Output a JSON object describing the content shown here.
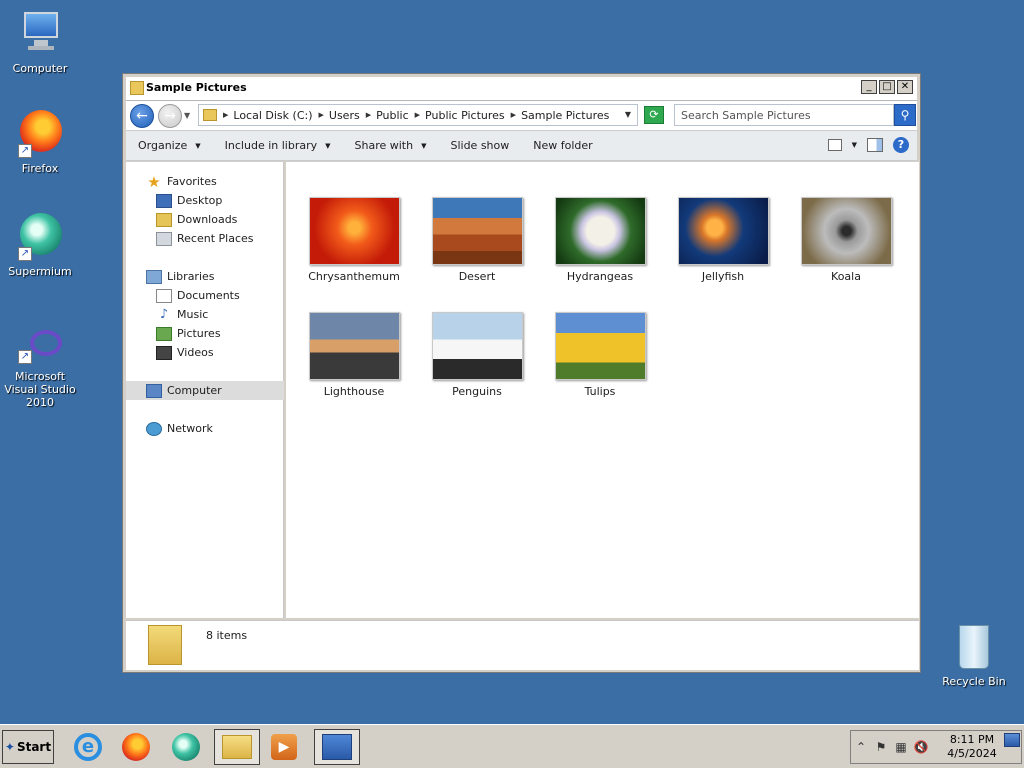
{
  "desktop": {
    "icons": [
      {
        "label": "Computer"
      },
      {
        "label": "Firefox"
      },
      {
        "label": "Supermium"
      },
      {
        "label": "Microsoft Visual Studio 2010"
      }
    ],
    "recycle_bin": {
      "label": "Recycle Bin"
    }
  },
  "window": {
    "title": "Sample Pictures",
    "controls": {
      "minimize": "_",
      "maximize": "□",
      "close": "✕"
    },
    "breadcrumbs": [
      "Local Disk (C:)",
      "Users",
      "Public",
      "Public Pictures",
      "Sample Pictures"
    ],
    "search": {
      "placeholder": "Search Sample Pictures"
    },
    "toolbar": {
      "organize": "Organize",
      "include_in_library": "Include in library",
      "share_with": "Share with",
      "slide_show": "Slide show",
      "new_folder": "New folder"
    },
    "nav": {
      "favorites": "Favorites",
      "desktop": "Desktop",
      "downloads": "Downloads",
      "recent_places": "Recent Places",
      "libraries": "Libraries",
      "documents": "Documents",
      "music": "Music",
      "pictures": "Pictures",
      "videos": "Videos",
      "computer": "Computer",
      "network": "Network"
    },
    "files": [
      {
        "name": "Chrysanthemum"
      },
      {
        "name": "Desert"
      },
      {
        "name": "Hydrangeas"
      },
      {
        "name": "Jellyfish"
      },
      {
        "name": "Koala"
      },
      {
        "name": "Lighthouse"
      },
      {
        "name": "Penguins"
      },
      {
        "name": "Tulips"
      }
    ],
    "details": {
      "count": "8 items"
    }
  },
  "taskbar": {
    "start_label": "Start",
    "clock_time": "8:11 PM",
    "clock_date": "4/5/2024"
  }
}
